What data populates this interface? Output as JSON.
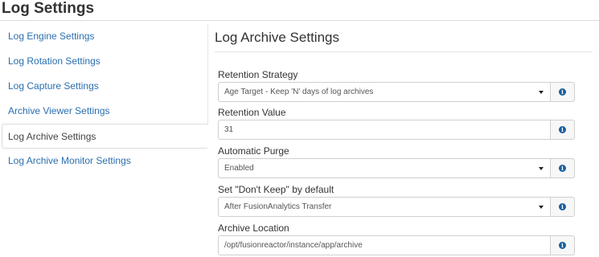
{
  "page": {
    "title": "Log Settings"
  },
  "sidebar": {
    "items": [
      {
        "label": "Log Engine Settings"
      },
      {
        "label": "Log Rotation Settings"
      },
      {
        "label": "Log Capture Settings"
      },
      {
        "label": "Archive Viewer Settings"
      },
      {
        "label": "Log Archive Settings",
        "active": true
      },
      {
        "label": "Log Archive Monitor Settings"
      }
    ]
  },
  "main": {
    "section_title": "Log Archive Settings",
    "fields": {
      "retention_strategy": {
        "label": "Retention Strategy",
        "value": "Age Target - Keep 'N' days of log archives"
      },
      "retention_value": {
        "label": "Retention Value",
        "value": "31"
      },
      "automatic_purge": {
        "label": "Automatic Purge",
        "value": "Enabled"
      },
      "dont_keep_default": {
        "label": "Set \"Don't Keep\" by default",
        "value": "After FusionAnalytics Transfer"
      },
      "archive_location": {
        "label": "Archive Location",
        "value": "/opt/fusionreactor/instance/app/archive"
      }
    },
    "info_icon_glyph": "i"
  },
  "colors": {
    "link": "#2a6fb0",
    "info_icon": "#1a5f9e",
    "border": "#cfcfcf"
  },
  "icons": {
    "info": "info-circle-icon",
    "dropdown": "caret-down-icon"
  }
}
